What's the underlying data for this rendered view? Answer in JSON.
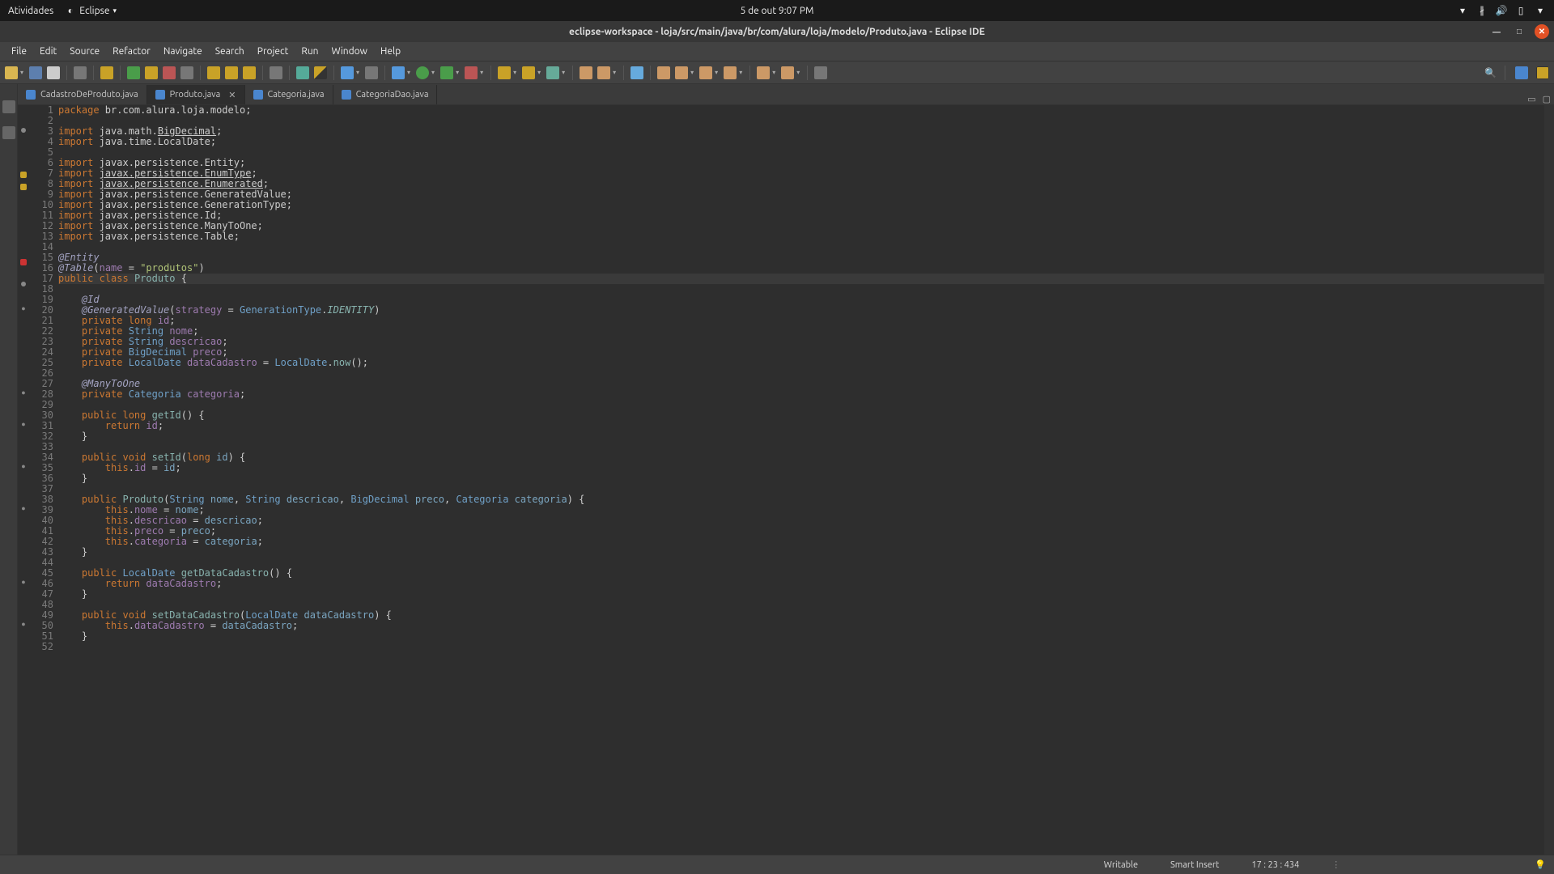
{
  "gnome": {
    "activities": "Atividades",
    "app_name": "Eclipse",
    "datetime": "5 de out  9:07 PM"
  },
  "window": {
    "title": "eclipse-workspace - loja/src/main/java/br/com/alura/loja/modelo/Produto.java - Eclipse IDE"
  },
  "menu": {
    "items": [
      "File",
      "Edit",
      "Source",
      "Refactor",
      "Navigate",
      "Search",
      "Project",
      "Run",
      "Window",
      "Help"
    ]
  },
  "tabs": [
    {
      "label": "CadastroDeProduto.java",
      "active": false
    },
    {
      "label": "Produto.java",
      "active": true
    },
    {
      "label": "Categoria.java",
      "active": false
    },
    {
      "label": "CategoriaDao.java",
      "active": false
    }
  ],
  "status": {
    "writable": "Writable",
    "insert": "Smart Insert",
    "position": "17 : 23 : 434"
  },
  "code": {
    "lines": [
      {
        "n": 1,
        "marker": "",
        "tokens": [
          [
            "kw",
            "package"
          ],
          [
            "",
            " br.com.alura.loja.modelo;"
          ]
        ]
      },
      {
        "n": 2,
        "marker": "",
        "tokens": [
          [
            "",
            ""
          ]
        ]
      },
      {
        "n": 3,
        "marker": "dot",
        "tokens": [
          [
            "kw",
            "import"
          ],
          [
            "",
            " java.math."
          ],
          [
            "pkg",
            "BigDecimal"
          ],
          [
            "",
            ";"
          ]
        ]
      },
      {
        "n": 4,
        "marker": "",
        "tokens": [
          [
            "kw",
            "import"
          ],
          [
            "",
            " java.time.LocalDate;"
          ]
        ]
      },
      {
        "n": 5,
        "marker": "",
        "tokens": [
          [
            "",
            ""
          ]
        ]
      },
      {
        "n": 6,
        "marker": "",
        "tokens": [
          [
            "kw",
            "import"
          ],
          [
            "",
            " javax.persistence.Entity;"
          ]
        ]
      },
      {
        "n": 7,
        "marker": "warn",
        "tokens": [
          [
            "kw",
            "import"
          ],
          [
            "",
            " "
          ],
          [
            "pkg",
            "javax.persistence.EnumType"
          ],
          [
            "",
            ";"
          ]
        ]
      },
      {
        "n": 8,
        "marker": "warn",
        "tokens": [
          [
            "kw",
            "import"
          ],
          [
            "",
            " "
          ],
          [
            "pkg",
            "javax.persistence.Enumerated"
          ],
          [
            "",
            ";"
          ]
        ]
      },
      {
        "n": 9,
        "marker": "",
        "tokens": [
          [
            "kw",
            "import"
          ],
          [
            "",
            " javax.persistence.GeneratedValue;"
          ]
        ]
      },
      {
        "n": 10,
        "marker": "",
        "tokens": [
          [
            "kw",
            "import"
          ],
          [
            "",
            " javax.persistence.GenerationType;"
          ]
        ]
      },
      {
        "n": 11,
        "marker": "",
        "tokens": [
          [
            "kw",
            "import"
          ],
          [
            "",
            " javax.persistence.Id;"
          ]
        ]
      },
      {
        "n": 12,
        "marker": "",
        "tokens": [
          [
            "kw",
            "import"
          ],
          [
            "",
            " javax.persistence.ManyToOne;"
          ]
        ]
      },
      {
        "n": 13,
        "marker": "",
        "tokens": [
          [
            "kw",
            "import"
          ],
          [
            "",
            " javax.persistence.Table;"
          ]
        ]
      },
      {
        "n": 14,
        "marker": "",
        "tokens": [
          [
            "",
            ""
          ]
        ]
      },
      {
        "n": 15,
        "marker": "err",
        "tokens": [
          [
            "ann",
            "@Entity"
          ]
        ]
      },
      {
        "n": 16,
        "marker": "",
        "tokens": [
          [
            "ann",
            "@Table"
          ],
          [
            "",
            "("
          ],
          [
            "field",
            "name"
          ],
          [
            "",
            " = "
          ],
          [
            "str",
            "\"produtos\""
          ],
          [
            "",
            ")"
          ]
        ]
      },
      {
        "n": 17,
        "marker": "dot",
        "current": true,
        "tokens": [
          [
            "kw",
            "public class"
          ],
          [
            "",
            " "
          ],
          [
            "cls",
            "Produto"
          ],
          [
            "",
            " {"
          ]
        ]
      },
      {
        "n": 18,
        "marker": "",
        "tokens": [
          [
            "",
            ""
          ]
        ]
      },
      {
        "n": 19,
        "marker": "bul",
        "tokens": [
          [
            "",
            "    "
          ],
          [
            "ann",
            "@Id"
          ]
        ]
      },
      {
        "n": 20,
        "marker": "",
        "tokens": [
          [
            "",
            "    "
          ],
          [
            "ann",
            "@GeneratedValue"
          ],
          [
            "",
            "("
          ],
          [
            "field",
            "strategy"
          ],
          [
            "",
            " = "
          ],
          [
            "type",
            "GenerationType"
          ],
          [
            "",
            "."
          ],
          [
            "id-const",
            "IDENTITY"
          ],
          [
            "",
            ")"
          ]
        ]
      },
      {
        "n": 21,
        "marker": "",
        "tokens": [
          [
            "",
            "    "
          ],
          [
            "kw",
            "private long"
          ],
          [
            "",
            " "
          ],
          [
            "field",
            "id"
          ],
          [
            "",
            ";"
          ]
        ]
      },
      {
        "n": 22,
        "marker": "",
        "tokens": [
          [
            "",
            "    "
          ],
          [
            "kw",
            "private"
          ],
          [
            "",
            " "
          ],
          [
            "type",
            "String"
          ],
          [
            "",
            " "
          ],
          [
            "field",
            "nome"
          ],
          [
            "",
            ";"
          ]
        ]
      },
      {
        "n": 23,
        "marker": "",
        "tokens": [
          [
            "",
            "    "
          ],
          [
            "kw",
            "private"
          ],
          [
            "",
            " "
          ],
          [
            "type",
            "String"
          ],
          [
            "",
            " "
          ],
          [
            "field",
            "descricao"
          ],
          [
            "",
            ";"
          ]
        ]
      },
      {
        "n": 24,
        "marker": "",
        "tokens": [
          [
            "",
            "    "
          ],
          [
            "kw",
            "private"
          ],
          [
            "",
            " "
          ],
          [
            "type",
            "BigDecimal"
          ],
          [
            "",
            " "
          ],
          [
            "field",
            "preco"
          ],
          [
            "",
            ";"
          ]
        ]
      },
      {
        "n": 25,
        "marker": "",
        "tokens": [
          [
            "",
            "    "
          ],
          [
            "kw",
            "private"
          ],
          [
            "",
            " "
          ],
          [
            "type",
            "LocalDate"
          ],
          [
            "",
            " "
          ],
          [
            "field",
            "dataCadastro"
          ],
          [
            "",
            " = "
          ],
          [
            "type",
            "LocalDate"
          ],
          [
            "",
            "."
          ],
          [
            "method",
            "now"
          ],
          [
            "",
            "();"
          ]
        ]
      },
      {
        "n": 26,
        "marker": "",
        "tokens": [
          [
            "",
            ""
          ]
        ]
      },
      {
        "n": 27,
        "marker": "bul",
        "tokens": [
          [
            "",
            "    "
          ],
          [
            "ann",
            "@ManyToOne"
          ]
        ]
      },
      {
        "n": 28,
        "marker": "",
        "tokens": [
          [
            "",
            "    "
          ],
          [
            "kw",
            "private"
          ],
          [
            "",
            " "
          ],
          [
            "type",
            "Categoria"
          ],
          [
            "",
            " "
          ],
          [
            "field",
            "categoria"
          ],
          [
            "",
            ";"
          ]
        ]
      },
      {
        "n": 29,
        "marker": "",
        "tokens": [
          [
            "",
            ""
          ]
        ]
      },
      {
        "n": 30,
        "marker": "bul",
        "tokens": [
          [
            "",
            "    "
          ],
          [
            "kw",
            "public long"
          ],
          [
            "",
            " "
          ],
          [
            "method",
            "getId"
          ],
          [
            "",
            "() {"
          ]
        ]
      },
      {
        "n": 31,
        "marker": "",
        "tokens": [
          [
            "",
            "        "
          ],
          [
            "kw",
            "return"
          ],
          [
            "",
            " "
          ],
          [
            "field",
            "id"
          ],
          [
            "",
            ";"
          ]
        ]
      },
      {
        "n": 32,
        "marker": "",
        "tokens": [
          [
            "",
            "    }"
          ]
        ]
      },
      {
        "n": 33,
        "marker": "",
        "tokens": [
          [
            "",
            ""
          ]
        ]
      },
      {
        "n": 34,
        "marker": "bul",
        "tokens": [
          [
            "",
            "    "
          ],
          [
            "kw",
            "public void"
          ],
          [
            "",
            " "
          ],
          [
            "method",
            "setId"
          ],
          [
            "",
            "("
          ],
          [
            "kw",
            "long"
          ],
          [
            "",
            " "
          ],
          [
            "param",
            "id"
          ],
          [
            "",
            ") {"
          ]
        ]
      },
      {
        "n": 35,
        "marker": "",
        "tokens": [
          [
            "",
            "        "
          ],
          [
            "kw",
            "this"
          ],
          [
            "",
            "."
          ],
          [
            "field",
            "id"
          ],
          [
            "",
            " = "
          ],
          [
            "param",
            "id"
          ],
          [
            "",
            ";"
          ]
        ]
      },
      {
        "n": 36,
        "marker": "",
        "tokens": [
          [
            "",
            "    }"
          ]
        ]
      },
      {
        "n": 37,
        "marker": "",
        "tokens": [
          [
            "",
            ""
          ]
        ]
      },
      {
        "n": 38,
        "marker": "bul",
        "tokens": [
          [
            "",
            "    "
          ],
          [
            "kw",
            "public"
          ],
          [
            "",
            " "
          ],
          [
            "cls",
            "Produto"
          ],
          [
            "",
            "("
          ],
          [
            "type",
            "String"
          ],
          [
            "",
            " "
          ],
          [
            "param",
            "nome"
          ],
          [
            "",
            ", "
          ],
          [
            "type",
            "String"
          ],
          [
            "",
            " "
          ],
          [
            "param",
            "descricao"
          ],
          [
            "",
            ", "
          ],
          [
            "type",
            "BigDecimal"
          ],
          [
            "",
            " "
          ],
          [
            "param",
            "preco"
          ],
          [
            "",
            ", "
          ],
          [
            "type",
            "Categoria"
          ],
          [
            "",
            " "
          ],
          [
            "param",
            "categoria"
          ],
          [
            "",
            ") {"
          ]
        ]
      },
      {
        "n": 39,
        "marker": "",
        "tokens": [
          [
            "",
            "        "
          ],
          [
            "kw",
            "this"
          ],
          [
            "",
            "."
          ],
          [
            "field",
            "nome"
          ],
          [
            "",
            " = "
          ],
          [
            "param",
            "nome"
          ],
          [
            "",
            ";"
          ]
        ]
      },
      {
        "n": 40,
        "marker": "",
        "tokens": [
          [
            "",
            "        "
          ],
          [
            "kw",
            "this"
          ],
          [
            "",
            "."
          ],
          [
            "field",
            "descricao"
          ],
          [
            "",
            " = "
          ],
          [
            "param",
            "descricao"
          ],
          [
            "",
            ";"
          ]
        ]
      },
      {
        "n": 41,
        "marker": "",
        "tokens": [
          [
            "",
            "        "
          ],
          [
            "kw",
            "this"
          ],
          [
            "",
            "."
          ],
          [
            "field",
            "preco"
          ],
          [
            "",
            " = "
          ],
          [
            "param",
            "preco"
          ],
          [
            "",
            ";"
          ]
        ]
      },
      {
        "n": 42,
        "marker": "",
        "tokens": [
          [
            "",
            "        "
          ],
          [
            "kw",
            "this"
          ],
          [
            "",
            "."
          ],
          [
            "field",
            "categoria"
          ],
          [
            "",
            " = "
          ],
          [
            "param",
            "categoria"
          ],
          [
            "",
            ";"
          ]
        ]
      },
      {
        "n": 43,
        "marker": "",
        "tokens": [
          [
            "",
            "    }"
          ]
        ]
      },
      {
        "n": 44,
        "marker": "",
        "tokens": [
          [
            "",
            ""
          ]
        ]
      },
      {
        "n": 45,
        "marker": "bul",
        "tokens": [
          [
            "",
            "    "
          ],
          [
            "kw",
            "public"
          ],
          [
            "",
            " "
          ],
          [
            "type",
            "LocalDate"
          ],
          [
            "",
            " "
          ],
          [
            "method",
            "getDataCadastro"
          ],
          [
            "",
            "() {"
          ]
        ]
      },
      {
        "n": 46,
        "marker": "",
        "tokens": [
          [
            "",
            "        "
          ],
          [
            "kw",
            "return"
          ],
          [
            "",
            " "
          ],
          [
            "field",
            "dataCadastro"
          ],
          [
            "",
            ";"
          ]
        ]
      },
      {
        "n": 47,
        "marker": "",
        "tokens": [
          [
            "",
            "    }"
          ]
        ]
      },
      {
        "n": 48,
        "marker": "",
        "tokens": [
          [
            "",
            ""
          ]
        ]
      },
      {
        "n": 49,
        "marker": "bul",
        "tokens": [
          [
            "",
            "    "
          ],
          [
            "kw",
            "public void"
          ],
          [
            "",
            " "
          ],
          [
            "method",
            "setDataCadastro"
          ],
          [
            "",
            "("
          ],
          [
            "type",
            "LocalDate"
          ],
          [
            "",
            " "
          ],
          [
            "param",
            "dataCadastro"
          ],
          [
            "",
            ") {"
          ]
        ]
      },
      {
        "n": 50,
        "marker": "",
        "tokens": [
          [
            "",
            "        "
          ],
          [
            "kw",
            "this"
          ],
          [
            "",
            "."
          ],
          [
            "field",
            "dataCadastro"
          ],
          [
            "",
            " = "
          ],
          [
            "param",
            "dataCadastro"
          ],
          [
            "",
            ";"
          ]
        ]
      },
      {
        "n": 51,
        "marker": "",
        "tokens": [
          [
            "",
            "    }"
          ]
        ]
      },
      {
        "n": 52,
        "marker": "",
        "tokens": [
          [
            "",
            ""
          ]
        ]
      }
    ]
  }
}
